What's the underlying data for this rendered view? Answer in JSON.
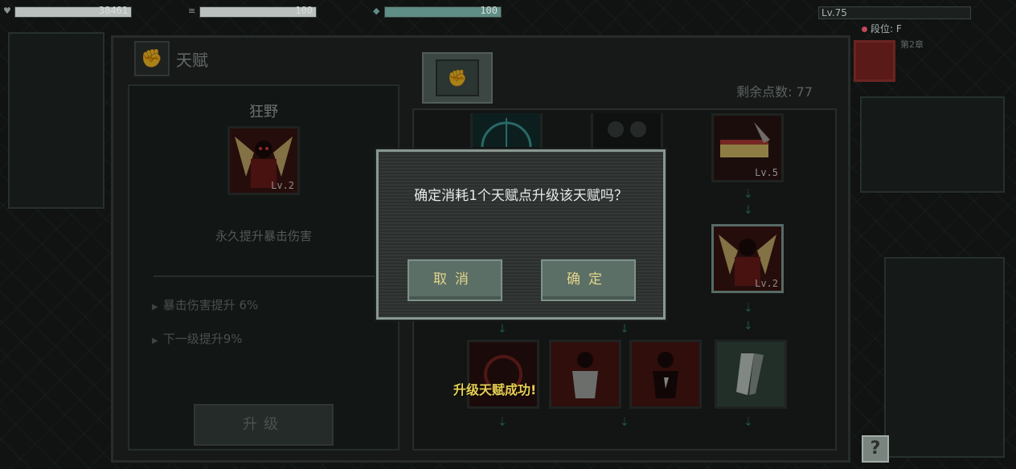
{
  "hud": {
    "hp_value": "38461",
    "hp_fill": 1.0,
    "stamina_value": "100",
    "stamina_fill": 1.0,
    "mana_value": "100",
    "mana_fill": 1.0,
    "level": "Lv.75",
    "rank": "段位: F",
    "rank_sub": "第2章"
  },
  "panel": {
    "title": "天赋",
    "remaining_points": "剩余点数: 77"
  },
  "detail": {
    "name": "狂野",
    "icon_level": "Lv.2",
    "description": "永久提升暴击伤害",
    "stats": [
      "暴击伤害提升 6%",
      "下一级提升9%"
    ],
    "upgrade_label": "升级"
  },
  "tree": {
    "nodes": [
      {
        "name": "crosshair-talent",
        "level": ""
      },
      {
        "name": "group-talent",
        "level": ""
      },
      {
        "name": "blade-talent",
        "level": "Lv.5"
      },
      {
        "name": "wild-talent",
        "level": "Lv.2"
      },
      {
        "name": "target-talent",
        "level": ""
      },
      {
        "name": "guard-talent",
        "level": ""
      },
      {
        "name": "power-talent",
        "level": ""
      },
      {
        "name": "ammo-talent",
        "level": ""
      }
    ]
  },
  "dialog": {
    "question": "确定消耗1个天赋点升级该天赋吗？",
    "cancel_label": "取消",
    "confirm_label": "确定"
  },
  "toast": "升级天赋成功!",
  "help_label": "?",
  "colors": {
    "hp": "#b9c0bd",
    "stamina": "#b9c0bd",
    "mana": "#5e8e86",
    "accent": "#e6cf52"
  }
}
